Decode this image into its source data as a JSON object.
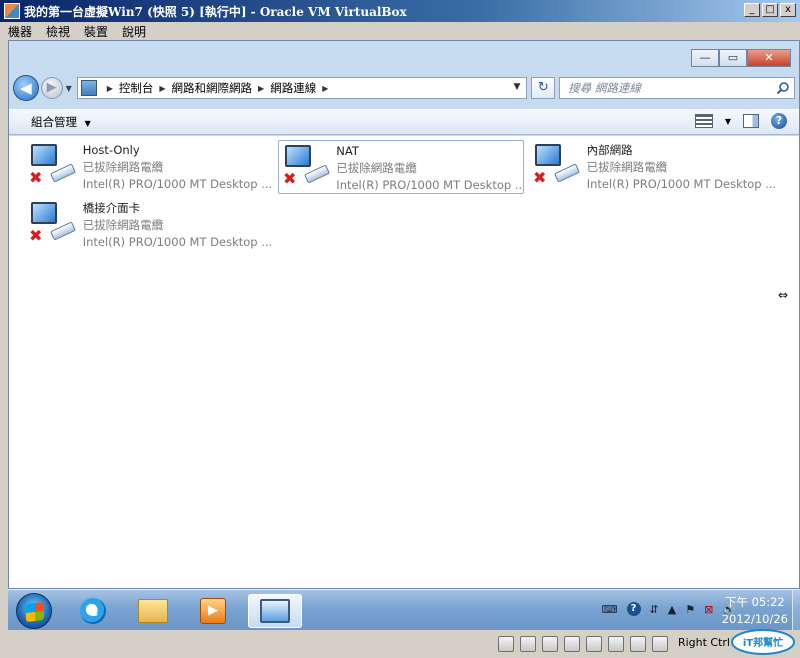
{
  "vbox": {
    "title": "我的第一台虛擬Win7 (快照 5) [執行中] - Oracle VM VirtualBox",
    "menu": [
      "機器",
      "檢視",
      "裝置",
      "說明"
    ],
    "host_key": "Right Ctrl"
  },
  "explorer": {
    "breadcrumb": [
      "控制台",
      "網路和網際網路",
      "網路連線"
    ],
    "search_placeholder": "搜尋 網路連線",
    "organize_label": "組合管理",
    "organize_arrow": "▼",
    "connections": [
      {
        "name": "Host-Only",
        "status": "已拔除網路電纜",
        "device": "Intel(R) PRO/1000 MT Desktop ..."
      },
      {
        "name": "NAT",
        "status": "已拔除網路電纜",
        "device": "Intel(R) PRO/1000 MT Desktop ..."
      },
      {
        "name": "內部網路",
        "status": "已拔除網路電纜",
        "device": "Intel(R) PRO/1000 MT Desktop ..."
      },
      {
        "name": "橋接介面卡",
        "status": "已拔除網路電纜",
        "device": "Intel(R) PRO/1000 MT Desktop ..."
      }
    ]
  },
  "taskbar": {
    "clock_time": "下午 05:22",
    "clock_date": "2012/10/26"
  },
  "watermark": "iT邦幫忙",
  "icons": {
    "back": "◀",
    "forward": "▶",
    "refresh": "↻",
    "help": "?",
    "close": "x",
    "minimize": "_",
    "maximize": "□",
    "disconnected": "✖",
    "media_play": "▶"
  }
}
